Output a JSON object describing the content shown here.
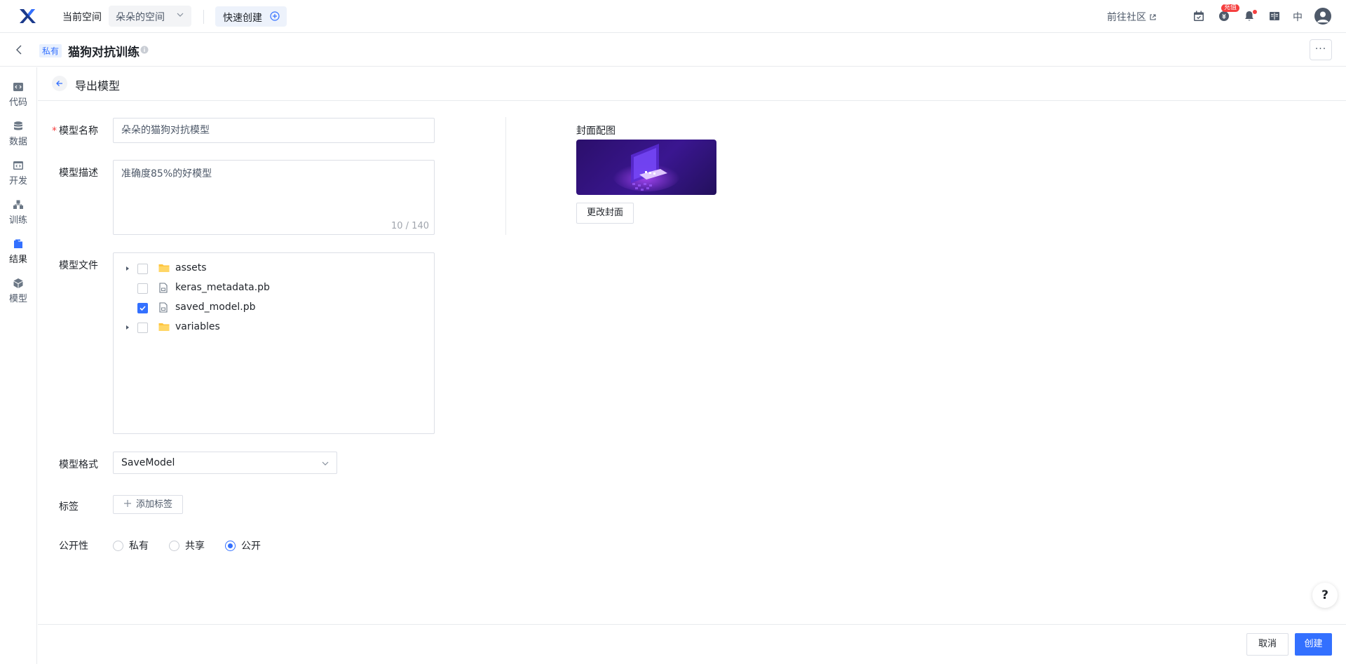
{
  "topbar": {
    "current_space_label": "当前空间",
    "space_name": "朵朵的空间",
    "quick_create": "快速创建",
    "community_link": "前往社区",
    "badge": "充值",
    "lang": "中"
  },
  "project": {
    "visibility_tag": "私有",
    "title": "猫狗对抗训练"
  },
  "sidebar": {
    "items": [
      {
        "label": "代码",
        "icon": "code-icon"
      },
      {
        "label": "数据",
        "icon": "database-icon"
      },
      {
        "label": "开发",
        "icon": "dev-icon"
      },
      {
        "label": "训练",
        "icon": "train-icon"
      },
      {
        "label": "结果",
        "icon": "result-icon"
      },
      {
        "label": "模型",
        "icon": "model-icon"
      }
    ]
  },
  "page": {
    "title": "导出模型"
  },
  "form": {
    "name_label": "模型名称",
    "name_value": "朵朵的猫狗对抗模型",
    "desc_label": "模型描述",
    "desc_value": "准确度85%的好模型",
    "desc_counter": "10 / 140",
    "files_label": "模型文件",
    "files": [
      {
        "name": "assets",
        "type": "folder",
        "checked": false,
        "expandable": true
      },
      {
        "name": "keras_metadata.pb",
        "type": "file",
        "checked": false,
        "expandable": false
      },
      {
        "name": "saved_model.pb",
        "type": "file",
        "checked": true,
        "expandable": false
      },
      {
        "name": "variables",
        "type": "folder",
        "checked": false,
        "expandable": true
      }
    ],
    "format_label": "模型格式",
    "format_value": "SaveModel",
    "tags_label": "标签",
    "add_tag": "添加标签",
    "visibility_label": "公开性",
    "visibility_options": [
      "私有",
      "共享",
      "公开"
    ],
    "visibility_selected": "公开",
    "cover_label": "封面配图",
    "change_cover": "更改封面"
  },
  "footer": {
    "cancel": "取消",
    "create": "创建"
  },
  "help": "?",
  "colors": {
    "primary": "#3370ff",
    "danger": "#f53f3f",
    "folder": "#ffc53d"
  }
}
